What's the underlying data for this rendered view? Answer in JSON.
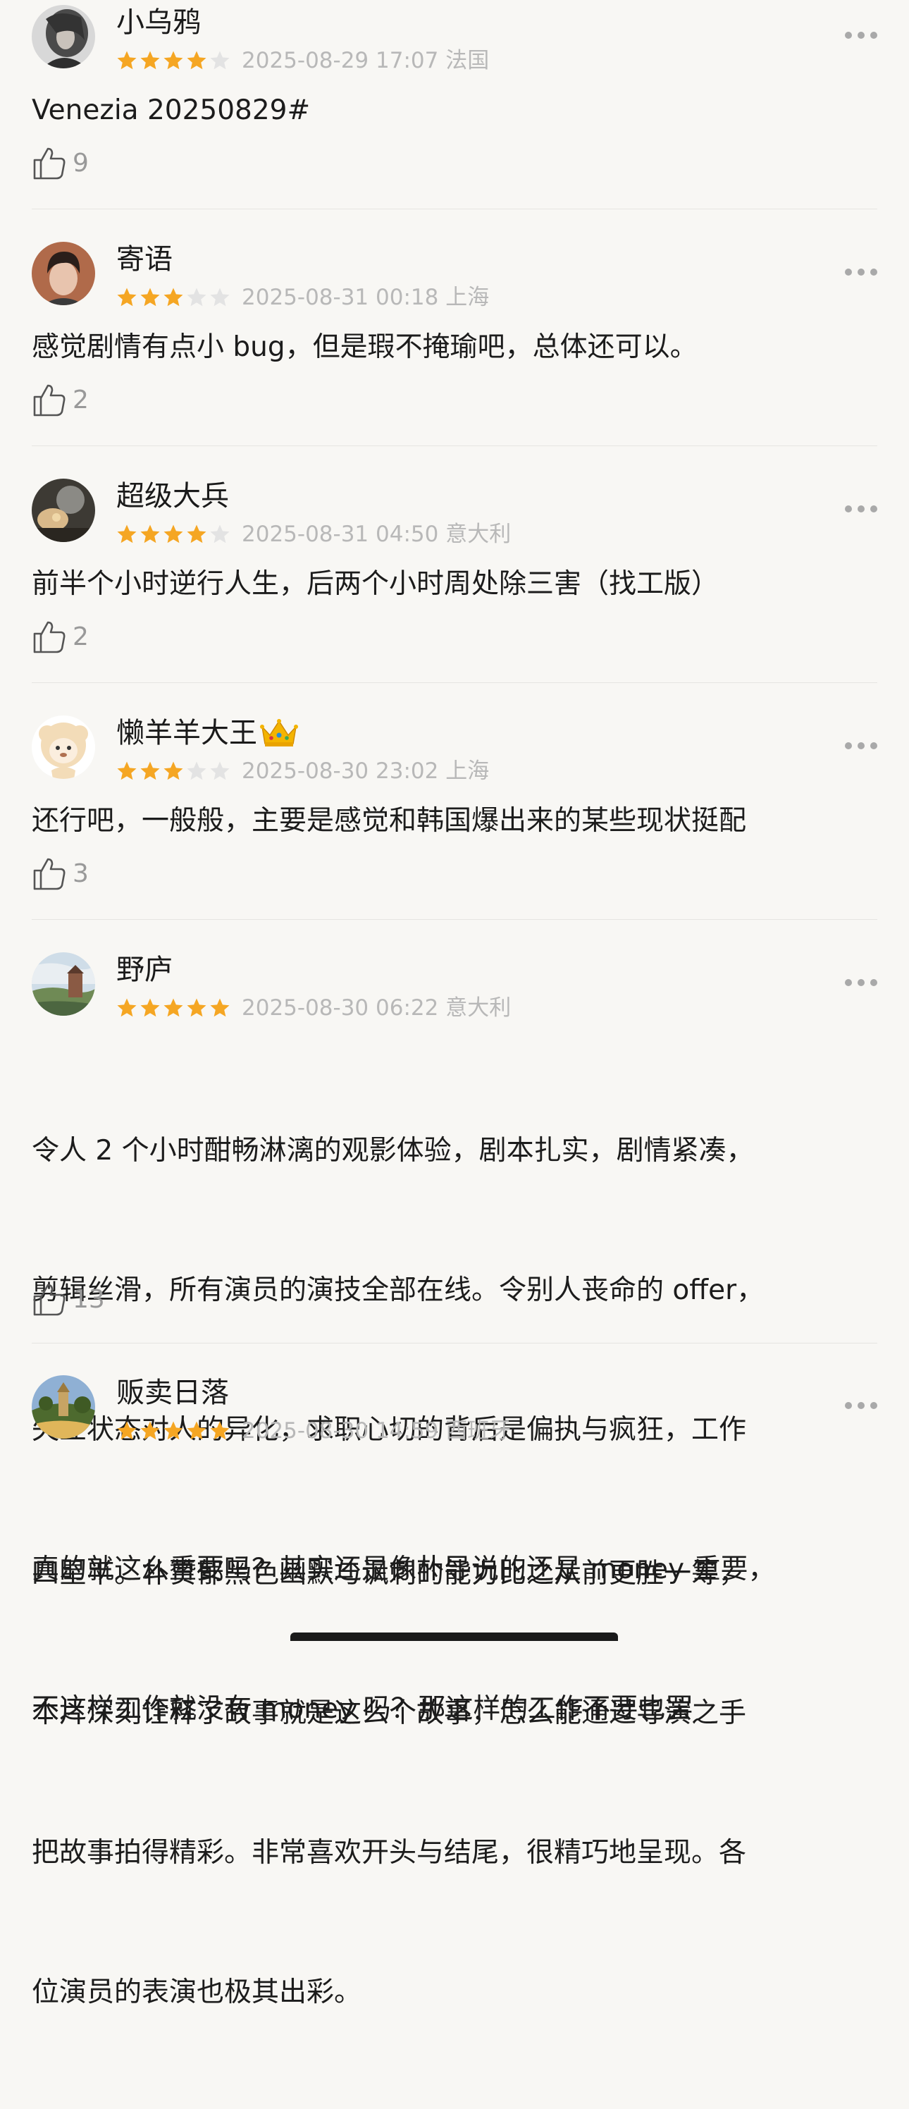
{
  "reviews": [
    {
      "username": "小乌鸦",
      "rating": 4,
      "timestamp": "2025-08-29 17:07",
      "location": "法国",
      "content": "Venezia 20250829#",
      "likes": "9",
      "avatar_icon": "user-avatar"
    },
    {
      "username": "寄语",
      "rating": 3,
      "timestamp": "2025-08-31 00:18",
      "location": "上海",
      "content": "感觉剧情有点小 bug，但是瑕不掩瑜吧，总体还可以。",
      "likes": "2",
      "avatar_icon": "user-avatar"
    },
    {
      "username": "超级大兵",
      "rating": 4,
      "timestamp": "2025-08-31 04:50",
      "location": "意大利",
      "content": "前半个小时逆行人生，后两个小时周处除三害（找工版）",
      "likes": "2",
      "avatar_icon": "user-avatar"
    },
    {
      "username": "懒羊羊大王",
      "rating": 3,
      "timestamp": "2025-08-30 23:02",
      "location": "上海",
      "content": "还行吧，一般般，主要是感觉和韩国爆出来的某些现状挺配",
      "likes": "3",
      "avatar_icon": "user-avatar",
      "badge_icon": "crown-icon"
    },
    {
      "username": "野庐",
      "rating": 5,
      "timestamp": "2025-08-30 06:22",
      "location": "意大利",
      "content_lines": [
        "令人 2 个小时酣畅淋漓的观影体验，剧本扎实，剧情紧凑，",
        "剪辑丝滑，所有演员的演技全部在线。令别人丧命的 offer，",
        "失业状态对人的异化，求职心切的背后是偏执与疯狂，工作",
        "真的就这么重要吗？其实还是像朴导说的还是 money 重要，",
        "不这样工作就没有 money 吗？那这样的工作不要也罢"
      ],
      "likes": "13",
      "avatar_icon": "user-avatar"
    },
    {
      "username": "贩卖日落",
      "rating": 5,
      "timestamp": "2025-08-30 14:59",
      "location": "西班牙",
      "content_lines": [
        "四星半。朴赞郁黑色幽默与讽刺的能力比之从前更胜一筹，",
        "本片深刻诠释了故事就是这么个故事，怎么能通过导演之手",
        "把故事拍得精彩。非常喜欢开头与结尾，很精巧地呈现。各",
        "位演员的表演也极其出彩。"
      ],
      "avatar_icon": "user-avatar"
    }
  ],
  "colors": {
    "star_filled": "#f5a623",
    "star_empty": "#e3e3e3",
    "background": "#f8f7f4",
    "meta_text": "#b8b8b8"
  }
}
